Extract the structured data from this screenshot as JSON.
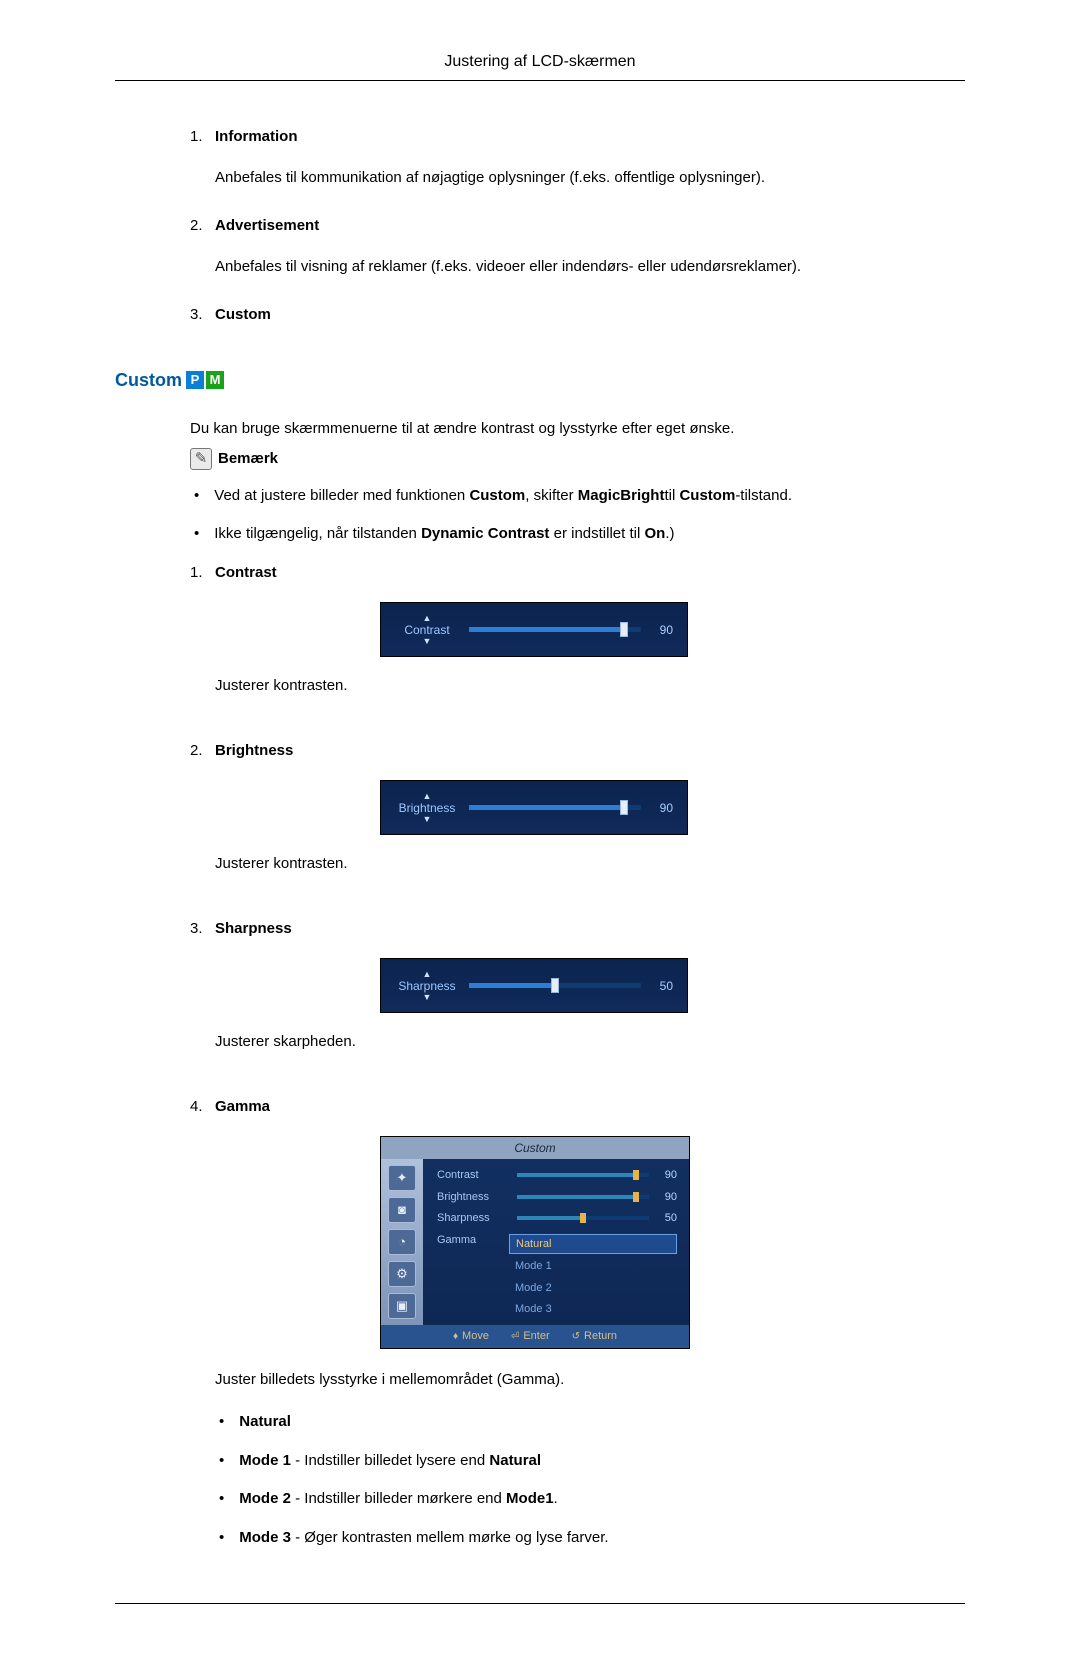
{
  "header": {
    "title": "Justering af LCD-skærmen"
  },
  "topList": [
    {
      "num": "1.",
      "title": "Information",
      "text": "Anbefales til kommunikation af nøjagtige oplysninger (f.eks. offentlige oplysninger)."
    },
    {
      "num": "2.",
      "title": "Advertisement",
      "text": "Anbefales til visning af reklamer (f.eks. videoer eller indendørs- eller udendørsreklamer)."
    },
    {
      "num": "3.",
      "title": "Custom",
      "text": ""
    }
  ],
  "section": {
    "heading": "Custom",
    "badge": {
      "p": "P",
      "m": "M"
    },
    "intro": "Du kan bruge skærmmenuerne til at ændre kontrast og lysstyrke efter eget ønske.",
    "noteLabel": "Bemærk",
    "notes": [
      {
        "pre": "Ved at justere billeder med funktionen ",
        "b1": "Custom",
        "mid1": ", skifter ",
        "b2": "MagicBright",
        "mid2": "til ",
        "b3": "Custom",
        "post": "-tilstand."
      },
      {
        "pre": "Ikke tilgængelig, når tilstanden ",
        "b1": "Dynamic Contrast",
        "mid1": " er indstillet til ",
        "b2": "On",
        "post": ".)"
      }
    ],
    "items": [
      {
        "num": "1.",
        "title": "Contrast",
        "slider": {
          "label": "Contrast",
          "value": "90",
          "percent": 90
        },
        "desc": "Justerer kontrasten."
      },
      {
        "num": "2.",
        "title": "Brightness",
        "slider": {
          "label": "Brightness",
          "value": "90",
          "percent": 90
        },
        "desc": "Justerer kontrasten."
      },
      {
        "num": "3.",
        "title": "Sharpness",
        "slider": {
          "label": "Sharpness",
          "value": "50",
          "percent": 50
        },
        "desc": "Justerer skarpheden."
      }
    ],
    "gamma": {
      "num": "4.",
      "title": "Gamma",
      "menuTitle": "Custom",
      "rows": [
        {
          "lbl": "Contrast",
          "val": "90",
          "pct": 90
        },
        {
          "lbl": "Brightness",
          "val": "90",
          "pct": 90
        },
        {
          "lbl": "Sharpness",
          "val": "50",
          "pct": 50
        }
      ],
      "gammaLabel": "Gamma",
      "options": [
        "Natural",
        "Mode 1",
        "Mode 2",
        "Mode 3"
      ],
      "footer": {
        "move": "Move",
        "enter": "Enter",
        "return": "Return"
      },
      "desc": "Juster billedets lysstyrke i mellemområdet (Gamma).",
      "bullets": [
        {
          "b": "Natural",
          "rest": ""
        },
        {
          "b": "Mode 1",
          "rest": " - Indstiller billedet lysere end ",
          "b2": "Natural"
        },
        {
          "b": "Mode 2",
          "rest": " - Indstiller billeder mørkere end ",
          "b2": "Mode1",
          "tail": "."
        },
        {
          "b": "Mode 3",
          "rest": " - Øger kontrasten mellem mørke og lyse farver."
        }
      ]
    }
  }
}
